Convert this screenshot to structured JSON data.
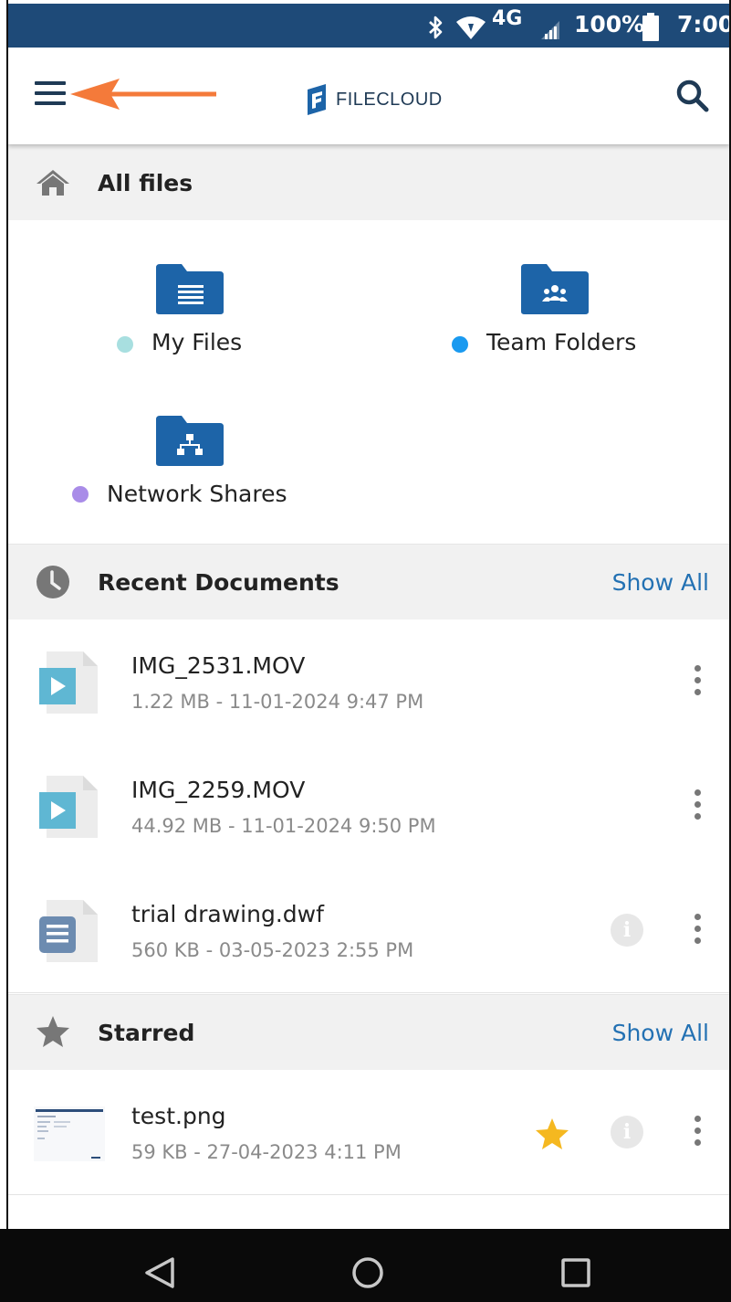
{
  "status_bar": {
    "bluetooth_icon": "bluetooth-icon",
    "wifi_icon": "wifi-icon",
    "network": "4G",
    "battery": "100%",
    "time": "7:00"
  },
  "app_bar": {
    "menu_icon": "hamburger-menu-icon",
    "logo_text": "FILECLOUD",
    "search_icon": "search-icon"
  },
  "all_files": {
    "title": "All files",
    "folders": [
      {
        "label": "My Files",
        "dot_color": "#a8dfe0"
      },
      {
        "label": "Team Folders",
        "dot_color": "#1a9af0"
      },
      {
        "label": "Network Shares",
        "dot_color": "#a98ce8"
      }
    ]
  },
  "recent": {
    "title": "Recent Documents",
    "show_all": "Show All",
    "items": [
      {
        "name": "IMG_2531.MOV",
        "meta": "1.22 MB - 11-01-2024 9:47 PM"
      },
      {
        "name": "IMG_2259.MOV",
        "meta": "44.92 MB - 11-01-2024 9:50 PM"
      },
      {
        "name": "trial drawing.dwf",
        "meta": "560 KB - 03-05-2023 2:55 PM"
      }
    ]
  },
  "starred": {
    "title": "Starred",
    "show_all": "Show All",
    "items": [
      {
        "name": "test.png",
        "meta": "59 KB - 27-04-2023 4:11 PM"
      }
    ]
  },
  "colors": {
    "status_bar": "#1e4a78",
    "folder_blue": "#1d64a8",
    "link_blue": "#2371b3",
    "annotation_arrow": "#f47a3a",
    "star": "#f5b820"
  }
}
